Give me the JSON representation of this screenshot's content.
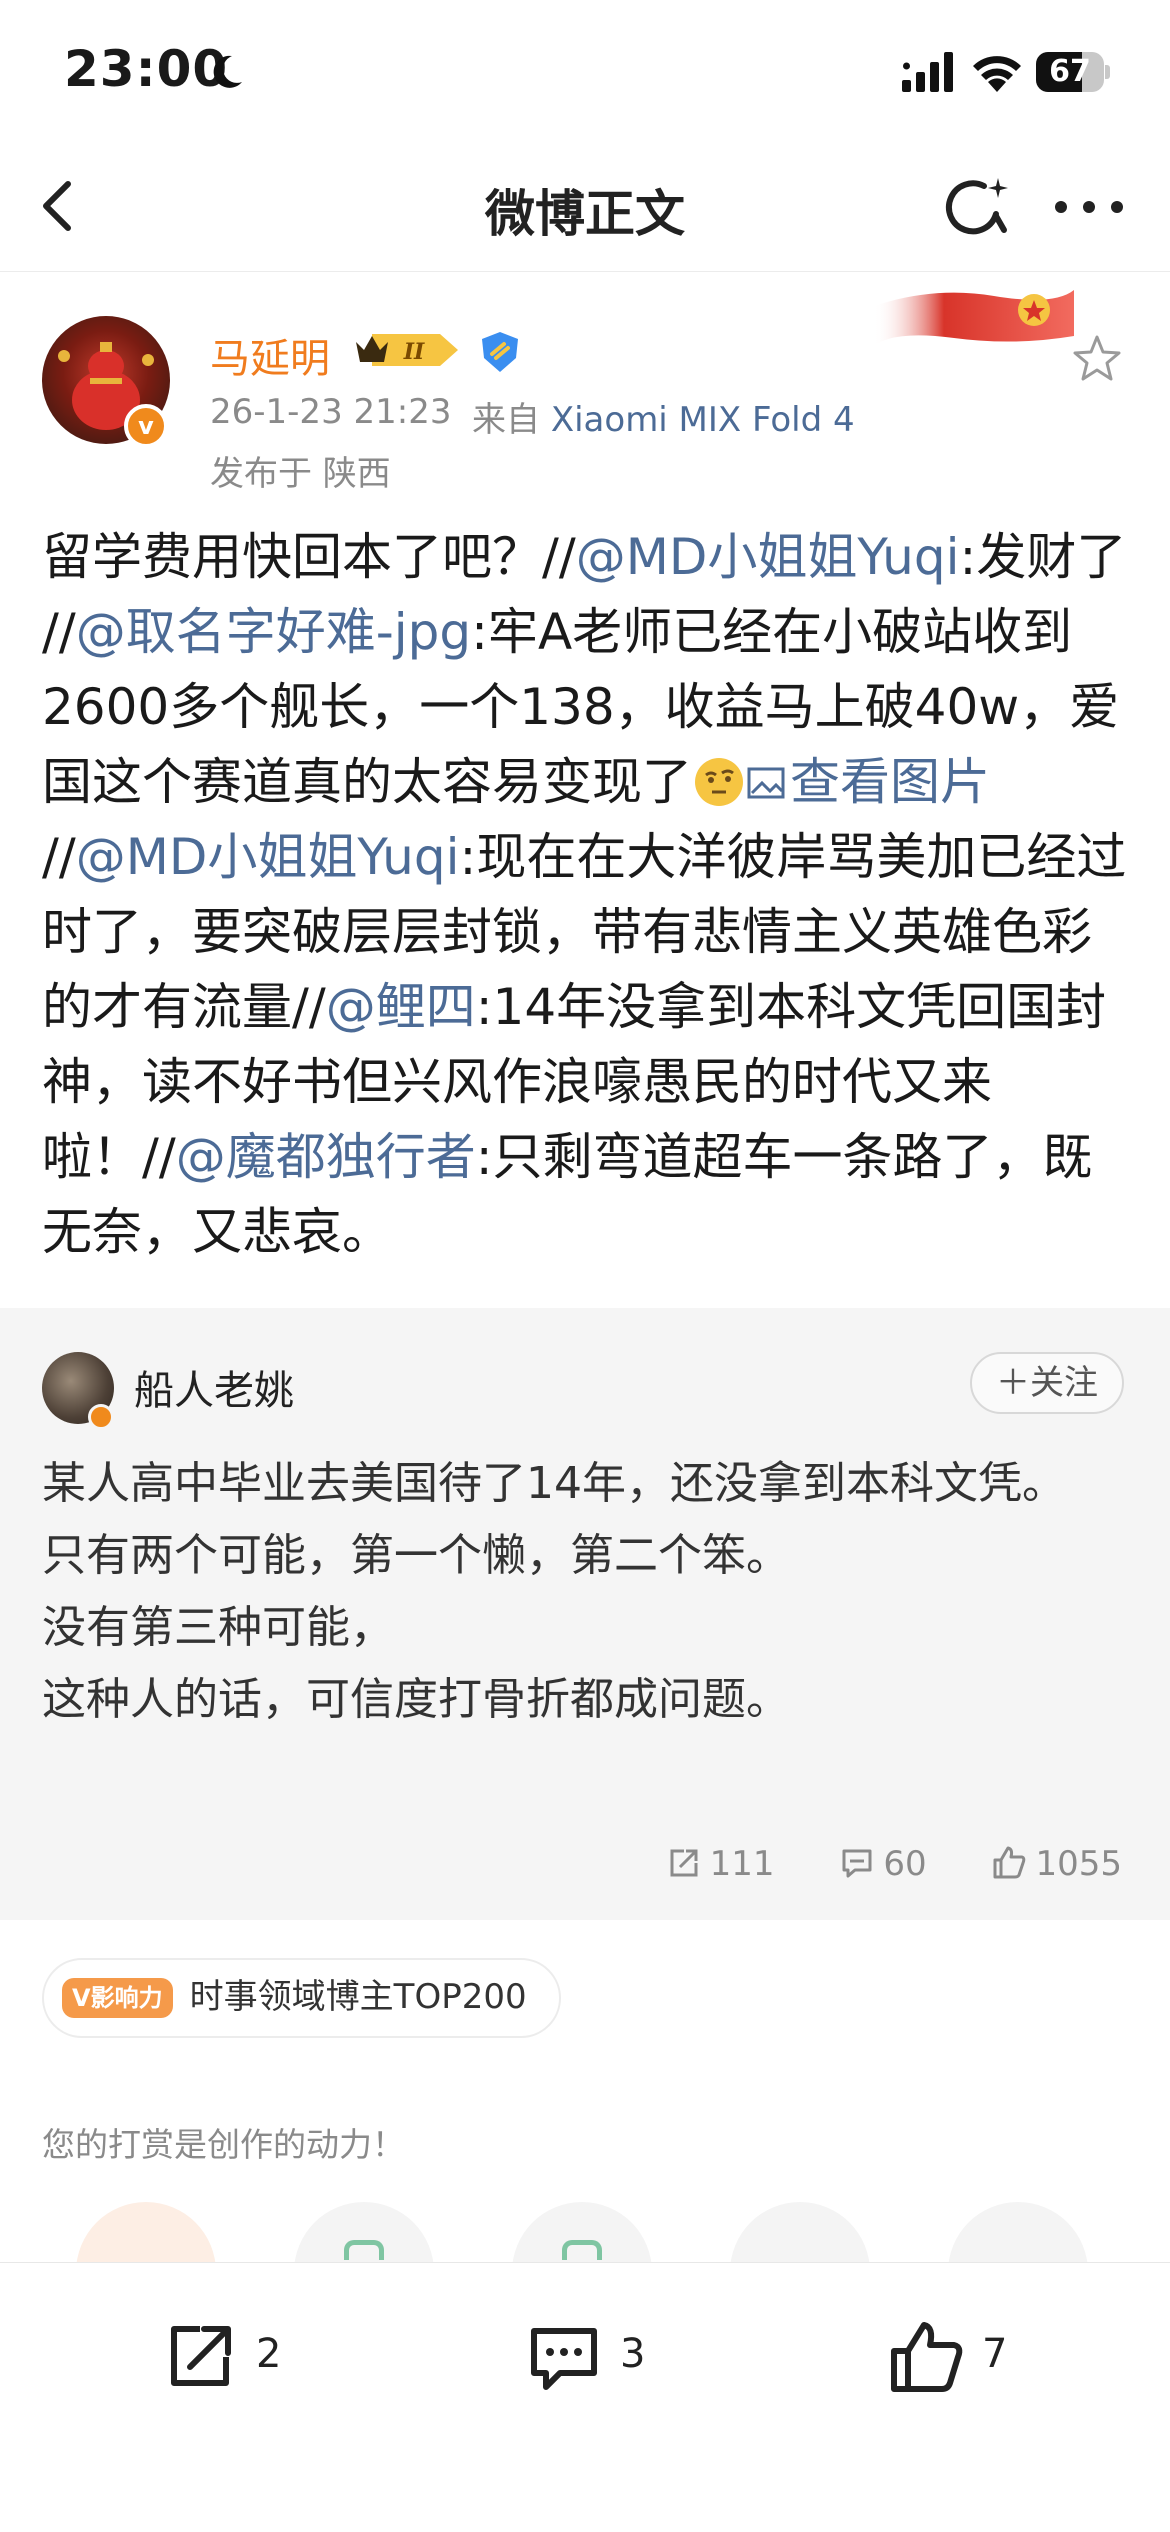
{
  "status_bar": {
    "time": "23:00",
    "battery": "67",
    "battery_level": 0.67
  },
  "nav": {
    "title": "微博正文"
  },
  "author": {
    "name": "马延明",
    "vip_level": "II",
    "time": "26-1-23 21:23",
    "from_prefix": "来自",
    "device": "Xiaomi MIX Fold 4",
    "location": "发布于 陕西",
    "avatar_badge": "v"
  },
  "post": {
    "segments": [
      {
        "t": "text",
        "v": "留学费用快回本了吧？//"
      },
      {
        "t": "mention",
        "v": "@MD小姐姐Yuqi"
      },
      {
        "t": "text",
        "v": ":发财了 //"
      },
      {
        "t": "mention",
        "v": "@取名字好难-jpg"
      },
      {
        "t": "text",
        "v": ":牢A老师已经在小破站收到2600多个舰长，一个138，收益马上破40w，爱国这个赛道真的太容易变现了"
      },
      {
        "t": "emoji",
        "v": "thinking-emoji"
      },
      {
        "t": "image_link",
        "v": "查看图片"
      },
      {
        "t": "text",
        "v": " //"
      },
      {
        "t": "mention",
        "v": "@MD小姐姐Yuqi"
      },
      {
        "t": "text",
        "v": ":现在在大洋彼岸骂美加已经过时了，要突破层层封锁，带有悲情主义英雄色彩的才有流量//"
      },
      {
        "t": "mention",
        "v": "@鲤四"
      },
      {
        "t": "text",
        "v": ":14年没拿到本科文凭回国封神，读不好书但兴风作浪嚎愚民的时代又来啦！//"
      },
      {
        "t": "mention",
        "v": "@魔都独行者"
      },
      {
        "t": "text",
        "v": ":只剩弯道超车一条路了，既无奈，又悲哀。"
      }
    ]
  },
  "comment": {
    "name": "船人老姚",
    "follow_label": "＋关注",
    "lines": [
      "某人高中毕业去美国待了14年，还没拿到本科文凭。",
      "只有两个可能，第一个懒，第二个笨。",
      "没有第三种可能，",
      "这种人的话，可信度打骨折都成问题。"
    ],
    "reposts": "111",
    "comments": "60",
    "likes": "1055"
  },
  "tag": {
    "badge": "V影响力",
    "text": "时事领域博主TOP200"
  },
  "reward": {
    "text": "您的打赏是创作的动力！"
  },
  "toolbar": {
    "reposts": "2",
    "comments": "3",
    "likes": "7"
  },
  "colors": {
    "accent_orange": "#f07c1e",
    "link_blue": "#4c6b96",
    "muted": "#8a8a8a",
    "card_bg": "#f5f5f5"
  }
}
